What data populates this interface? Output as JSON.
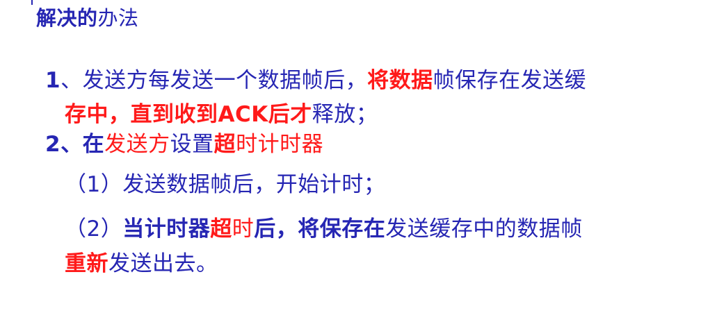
{
  "slide": {
    "heading": {
      "bold_part": "解决的",
      "normal_part": "办法"
    },
    "item1": {
      "line1": {
        "number": "1",
        "text_a": "、发送方每发送一个数据帧后，",
        "red_bold": "将数据",
        "text_b": "帧保存在发送缓"
      },
      "line2": {
        "red_bold_a": "存中，直到收到ACK后才",
        "text": "释放；"
      }
    },
    "item2": {
      "number_text": "2、在",
      "red_a": "发送方",
      "blue_a": "设置",
      "red_bold": "超",
      "red_b": "时计时器"
    },
    "sub1": {
      "num": "（1）",
      "text": "发送数据帧后，开始计时；"
    },
    "sub2": {
      "line1": {
        "num": "（2）",
        "blue_bold_a": "当计时器",
        "red_bold": "超",
        "red": "时",
        "blue_bold_b": "后，将保存在",
        "blue": "发送缓存中的数据帧"
      },
      "line2": {
        "red_bold": "重新",
        "blue": "发送出去。"
      }
    }
  }
}
